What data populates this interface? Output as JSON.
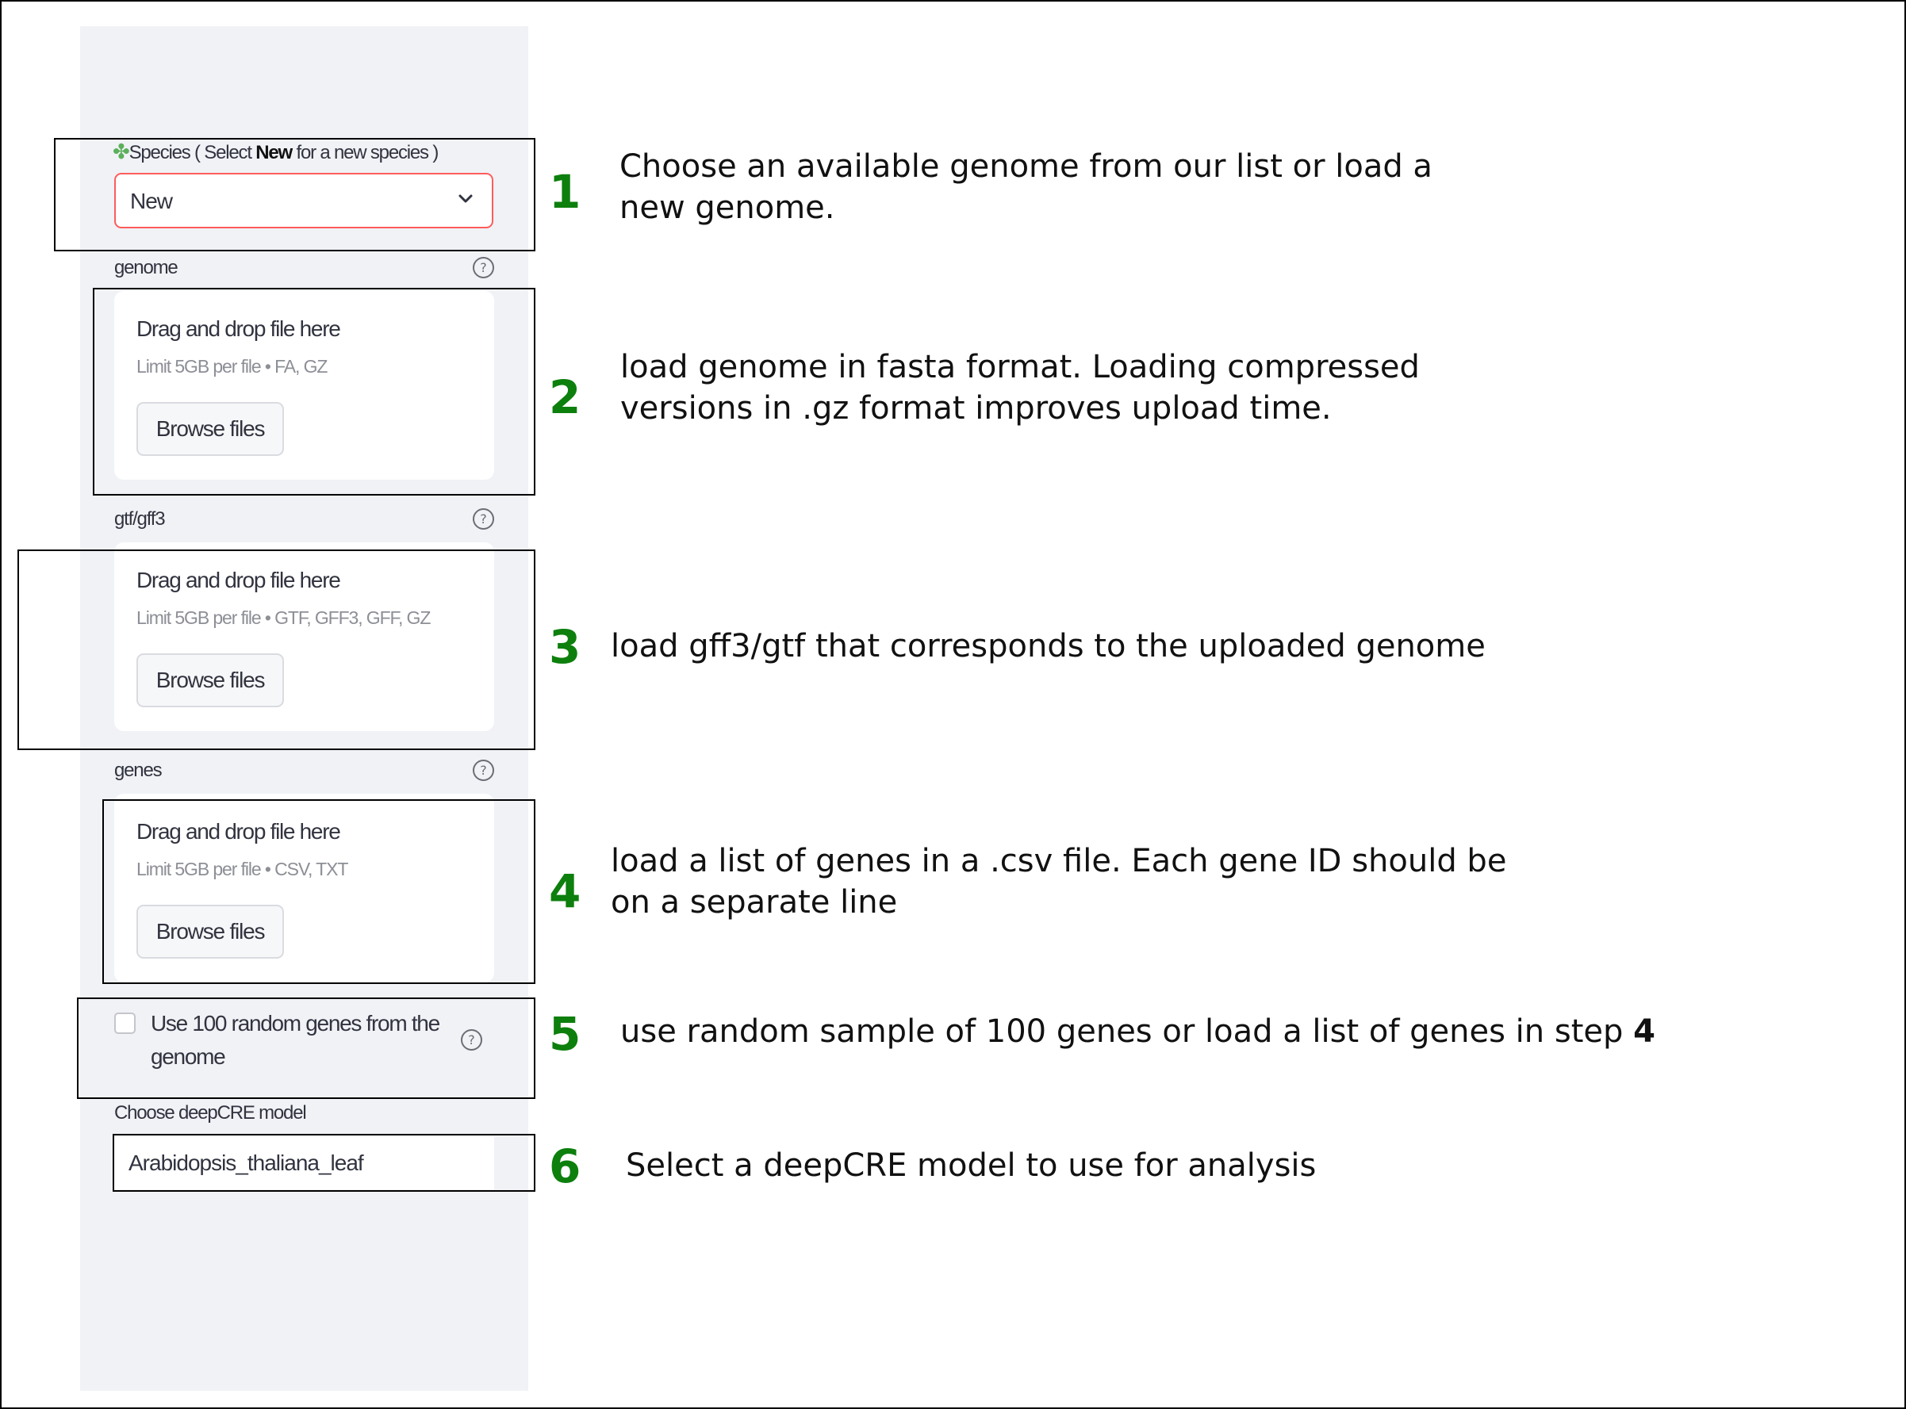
{
  "species": {
    "icon": "clover-icon",
    "label_prefix": "Species ( Select ",
    "label_bold": "New",
    "label_suffix": " for a new species )",
    "selected_value": "New"
  },
  "uploads": [
    {
      "label": "genome",
      "title": "Drag and drop file here",
      "limit": "Limit 5GB per file • FA, GZ",
      "button": "Browse files"
    },
    {
      "label": "gtf/gff3",
      "title": "Drag and drop file here",
      "limit": "Limit 5GB per file • GTF, GFF3, GFF, GZ",
      "button": "Browse files"
    },
    {
      "label": "genes",
      "title": "Drag and drop file here",
      "limit": "Limit 5GB per file • CSV, TXT",
      "button": "Browse files"
    }
  ],
  "random_genes": {
    "label": "Use 100 random genes from the genome",
    "checked": false
  },
  "model": {
    "label": "Choose deepCRE model",
    "value": "Arabidopsis_thaliana_leaf"
  },
  "steps": [
    {
      "num": "1",
      "text": "Choose an available genome from our list or load a new genome."
    },
    {
      "num": "2",
      "text": "load genome in fasta format. Loading compressed versions in .gz format improves upload time."
    },
    {
      "num": "3",
      "text": "load gff3/gtf that corresponds to the uploaded genome"
    },
    {
      "num": "4",
      "text": "load a list of genes in a .csv file. Each gene ID should be on a separate line"
    },
    {
      "num": "5",
      "text": "use random sample of 100 genes or load a list of genes in step ",
      "bold": "4"
    },
    {
      "num": "6",
      "text": "Select a deepCRE model to use for analysis"
    }
  ],
  "colors": {
    "sidebar": "#f0f2f6",
    "step_number": "#0d7f0d",
    "select_border": "#ff5c5c"
  }
}
